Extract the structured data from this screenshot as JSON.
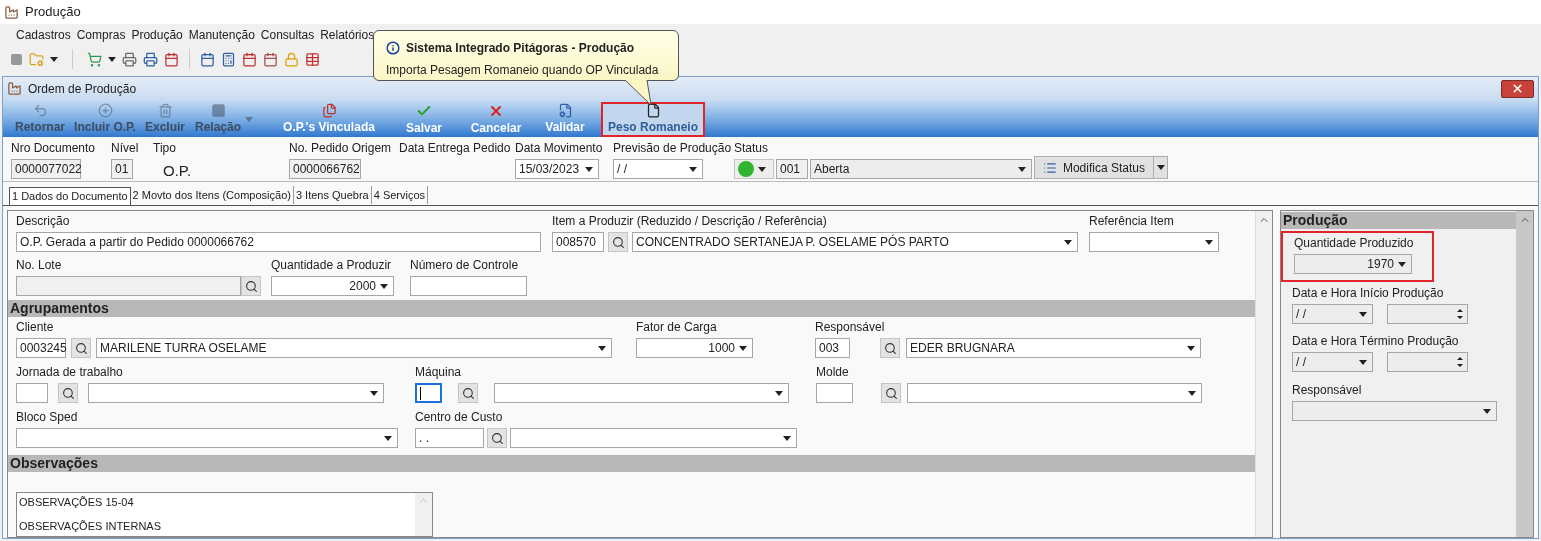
{
  "app": {
    "title": "Produção"
  },
  "menu": [
    {
      "label": "Cadastros"
    },
    {
      "label": "Compras"
    },
    {
      "label": "Produção"
    },
    {
      "label": "Manutenção"
    },
    {
      "label": "Consultas"
    },
    {
      "label": "Relatórios"
    }
  ],
  "tooltip": {
    "title": "Sistema Integrado Pitágoras - Produção",
    "text": "Importa Pesagem Romaneio quando OP Vinculada"
  },
  "window": {
    "title": "Ordem de Produção"
  },
  "actions": [
    {
      "label": "Retornar",
      "kind": "button",
      "disabled": true,
      "highlighted": false
    },
    {
      "label": "Incluir O.P.",
      "kind": "button",
      "disabled": true,
      "highlighted": false
    },
    {
      "label": "Excluir",
      "kind": "button",
      "disabled": true,
      "highlighted": false
    },
    {
      "label": "Relação",
      "kind": "split",
      "disabled": true,
      "highlighted": false
    },
    {
      "label": "O.P.'s Vinculada",
      "kind": "button",
      "disabled": false,
      "highlighted": false
    },
    {
      "label": "Salvar",
      "kind": "button",
      "disabled": false,
      "highlighted": false
    },
    {
      "label": "Cancelar",
      "kind": "button",
      "disabled": false,
      "highlighted": false
    },
    {
      "label": "Validar",
      "kind": "button",
      "disabled": false,
      "highlighted": false
    },
    {
      "label": "Peso Romaneio",
      "kind": "button",
      "disabled": false,
      "highlighted": true
    }
  ],
  "header": {
    "nro_documento": {
      "label": "Nro Documento",
      "value": "0000077022"
    },
    "nivel": {
      "label": "Nível",
      "value": "01"
    },
    "tipo": {
      "label": "Tipo",
      "value": "O.P."
    },
    "pedido_origem": {
      "label": "No. Pedido Origem",
      "value": "0000066762"
    },
    "data_entrega": {
      "label": "Data Entrega Pedido"
    },
    "data_movimento": {
      "label": "Data Movimento",
      "value": "15/03/2023"
    },
    "previsao": {
      "label": "Previsão de Produção",
      "value": "/ /"
    },
    "status": {
      "label": "Status",
      "color": "#2fb52f",
      "code": "001",
      "value": "Aberta"
    },
    "modify_button": {
      "label": "Modifica Status"
    }
  },
  "tabs": [
    {
      "label": "1 Dados do Documento",
      "selected": true
    },
    {
      "label": "2 Movto dos Itens (Composição)",
      "selected": false
    },
    {
      "label": "3 Itens Quebra",
      "selected": false
    },
    {
      "label": "4 Serviços",
      "selected": false
    }
  ],
  "form": {
    "descricao": {
      "label": "Descrição",
      "value": "O.P. Gerada a partir do Pedido 0000066762"
    },
    "item": {
      "label": "Item a Produzir (Reduzido / Descrição / Referência)",
      "code": "008570",
      "value": "CONCENTRADO SERTANEJA P. OSELAME PÓS PARTO"
    },
    "referencia": {
      "label": "Referência Item"
    },
    "lote": {
      "label": "No. Lote",
      "disabled": true
    },
    "quantidade": {
      "label": "Quantidade a Produzir",
      "value": "2000"
    },
    "controle": {
      "label": "Número de Controle"
    },
    "section": "Agrupamentos",
    "cliente": {
      "label": "Cliente",
      "code": "0003245",
      "value": "MARILENE TURRA OSELAME"
    },
    "fator": {
      "label": "Fator de Carga",
      "value": "1000"
    },
    "responsavel": {
      "label": "Responsável",
      "code": "003",
      "value": "EDER BRUGNARA"
    },
    "jornada": {
      "label": "Jornada de trabalho",
      "focused": false
    },
    "maquina": {
      "label": "Máquina",
      "focused": true
    },
    "molde": {
      "label": "Molde",
      "focused": false
    },
    "bloco": {
      "label": "Bloco Sped"
    },
    "centro": {
      "label": "Centro de Custo",
      "code": ".  ."
    },
    "notes_section": "Observações",
    "notes": [
      "OBSERVAÇÕES 15-04",
      "OBSERVAÇÕES INTERNAS"
    ]
  },
  "production": {
    "title": "Produção",
    "quantidade": {
      "label": "Quantidade Produzido",
      "value": "1970",
      "highlighted": true
    },
    "inicio": {
      "label": "Data e Hora Início Produção",
      "value": "/ /"
    },
    "termino": {
      "label": "Data e Hora Término Produção",
      "value": "/ /"
    },
    "responsavel": {
      "label": "Responsável"
    }
  }
}
